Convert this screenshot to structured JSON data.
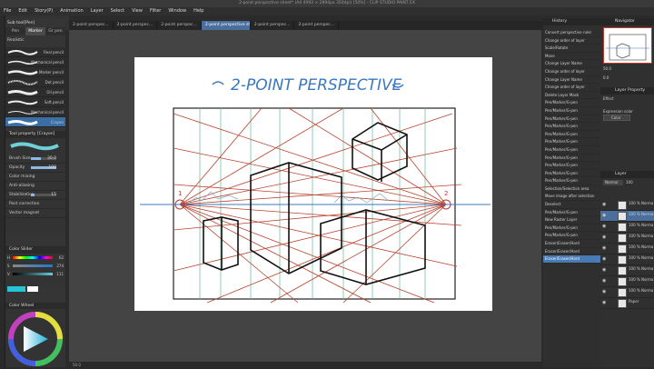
{
  "window": {
    "title": "2-point perspective sheet* (A4 4093 × 2894px 350dpi) [50%] - CLIP STUDIO PAINT EX"
  },
  "menu": [
    "File",
    "Edit",
    "Story(P)",
    "Animation",
    "Layer",
    "Select",
    "View",
    "Filter",
    "Window",
    "Help"
  ],
  "tabs": [
    "2-point perspec...",
    "2-point perspec...",
    "2-point perspec...",
    "2-point perspective sheet*",
    "2-point perspec...",
    "2-point perspec..."
  ],
  "subtool": {
    "title": "Sub tool[Pen]",
    "tabs": [
      "Pen",
      "Marker",
      "Gr pen"
    ],
    "header": "Realistic",
    "selected": "Crayon",
    "brushes": [
      "Real pencil",
      "Mechanical pencil",
      "Marker pencil",
      "Dot pencil",
      "Oil pencil",
      "Soft pencil",
      "Mechanical pencil",
      "Crayon"
    ]
  },
  "tool_property": {
    "title": "Tool property [Crayon]",
    "rows": [
      {
        "label": "Brush Size",
        "value": "30.0"
      },
      {
        "label": "Opacity",
        "value": "100"
      },
      {
        "label": "Color mixing",
        "value": ""
      },
      {
        "label": "Anti-aliasing",
        "value": ""
      },
      {
        "label": "Stabilization",
        "value": "15"
      },
      {
        "label": "Post correction",
        "value": ""
      },
      {
        "label": "Vector magnet",
        "value": ""
      }
    ]
  },
  "color_slider": {
    "title": "Color Slider",
    "H": "62",
    "S": "274",
    "V": "111"
  },
  "color_wheel": {
    "title": "Color Wheel"
  },
  "canvas": {
    "title": "2-POINT PERSPECTIVE",
    "vp_left": "1",
    "vp_right": "2"
  },
  "history": {
    "title": "History",
    "items": [
      "Convert perspective ruler",
      "Change order of layer",
      "Scale/Rotate",
      "Move",
      "Change Layer Name",
      "Change order of layer",
      "Change Layer Name",
      "Change order of layer",
      "Delete Layer Mask",
      "Pen/Marker/G-pen",
      "Pen/Marker/G-pen",
      "Pen/Marker/G-pen",
      "Pen/Marker/G-pen",
      "Pen/Marker/G-pen",
      "Pen/Marker/G-pen",
      "Pen/Marker/G-pen",
      "Pen/Marker/G-pen",
      "Pen/Marker/G-pen",
      "Pen/Marker/G-pen",
      "Pen/Marker/G-pen",
      "Selection/Selection area",
      "Move image after selection",
      "Deselect",
      "Pen/Marker/G-pen",
      "New Raster Layer",
      "Pen/Marker/G-pen",
      "Pen/Marker/G-pen",
      "Eraser/Eraser/Hard",
      "Eraser/Eraser/Hard",
      "Eraser/Eraser/Hard"
    ],
    "selected": 29
  },
  "navigator": {
    "title": "Navigator",
    "zoom": "50.0",
    "angle": "0.0"
  },
  "layer_property": {
    "title": "Layer Property",
    "effect": "Effect",
    "expression": "Expression color",
    "color_value": "Color"
  },
  "layers": {
    "title": "Layer",
    "blend": "Normal",
    "opacity": "100",
    "rows": [
      {
        "name": "100 % Normal Folder 2",
        "sel": false
      },
      {
        "name": "100 % Normal Layer 2",
        "sel": true
      },
      {
        "name": "100 % Normal Layer 3",
        "sel": false
      },
      {
        "name": "100 % Normal Layer 1",
        "sel": false
      },
      {
        "name": "100 % Normal Folder 1",
        "sel": false
      },
      {
        "name": "100 % Normal Green",
        "sel": false
      },
      {
        "name": "100 % Normal Blue",
        "sel": false
      },
      {
        "name": "100 % Normal Red",
        "sel": false
      },
      {
        "name": "100 % Normal Perspective",
        "sel": false
      },
      {
        "name": "Paper",
        "sel": false
      }
    ]
  },
  "status": {
    "zoom": "50.0"
  },
  "colors": {
    "accent": "#4a7ab5",
    "red_lines": "#b8432f",
    "green_lines": "#5fbf8f",
    "blue": "#3a78c0"
  }
}
